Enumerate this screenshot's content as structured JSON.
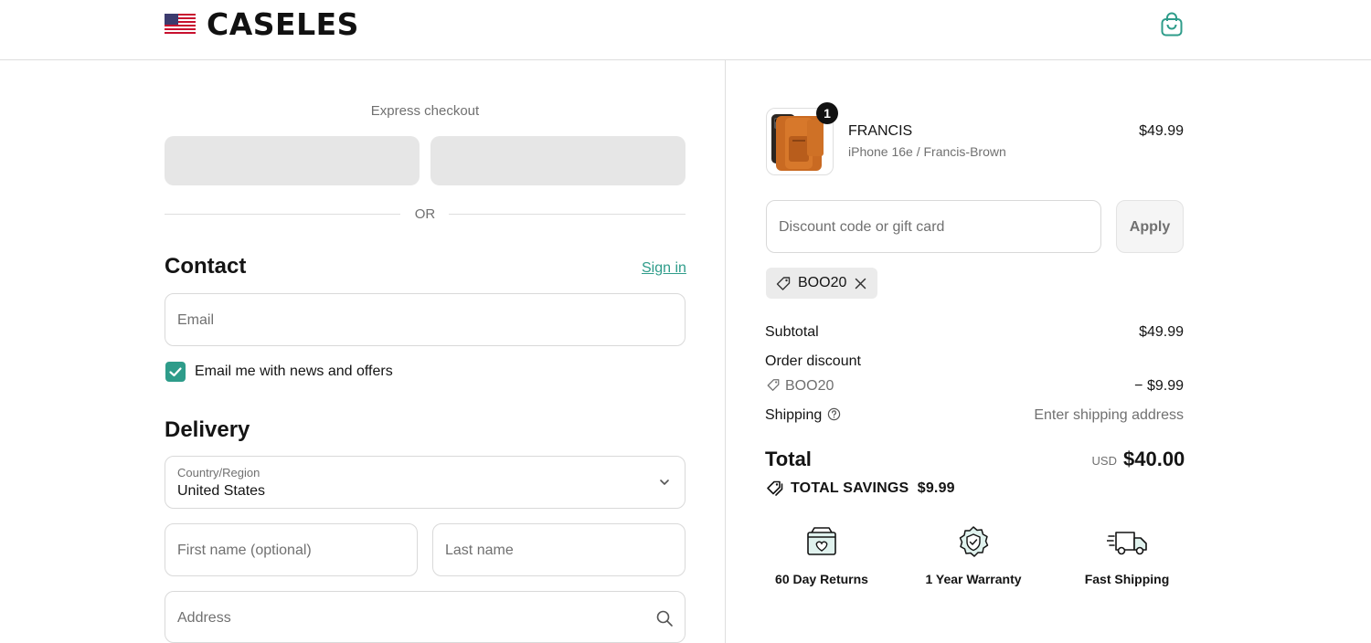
{
  "header": {
    "logo": "CASELES",
    "flag_icon": "us-flag-icon",
    "cart_icon": "shopping-bag-icon"
  },
  "express": {
    "title": "Express checkout",
    "or_label": "OR"
  },
  "contact": {
    "title": "Contact",
    "sign_in": "Sign in",
    "email_placeholder": "Email",
    "newsletter_label": "Email me with news and offers",
    "newsletter_checked": true
  },
  "delivery": {
    "title": "Delivery",
    "country_label": "Country/Region",
    "country_value": "United States",
    "first_name_placeholder": "First name (optional)",
    "last_name_placeholder": "Last name",
    "address_placeholder": "Address"
  },
  "order": {
    "product": {
      "name": "FRANCIS",
      "variant": "iPhone 16e / Francis-Brown",
      "price": "$49.99",
      "quantity": "1"
    },
    "discount_placeholder": "Discount code or gift card",
    "apply_label": "Apply",
    "applied_code": "BOO20",
    "subtotal_label": "Subtotal",
    "subtotal_value": "$49.99",
    "order_discount_label": "Order discount",
    "discount_code": "BOO20",
    "discount_value": "− $9.99",
    "shipping_label": "Shipping",
    "shipping_value": "Enter shipping address",
    "total_label": "Total",
    "total_currency": "USD",
    "total_value": "$40.00",
    "savings_label": "TOTAL SAVINGS",
    "savings_value": "$9.99"
  },
  "features": [
    {
      "label": "60 Day Returns",
      "icon": "returns-box-icon"
    },
    {
      "label": "1 Year Warranty",
      "icon": "warranty-shield-icon"
    },
    {
      "label": "Fast Shipping",
      "icon": "delivery-truck-icon"
    }
  ],
  "colors": {
    "accent": "#2e9c8a",
    "button_placeholder": "#e6e6e6",
    "border": "#d9d9d9"
  }
}
